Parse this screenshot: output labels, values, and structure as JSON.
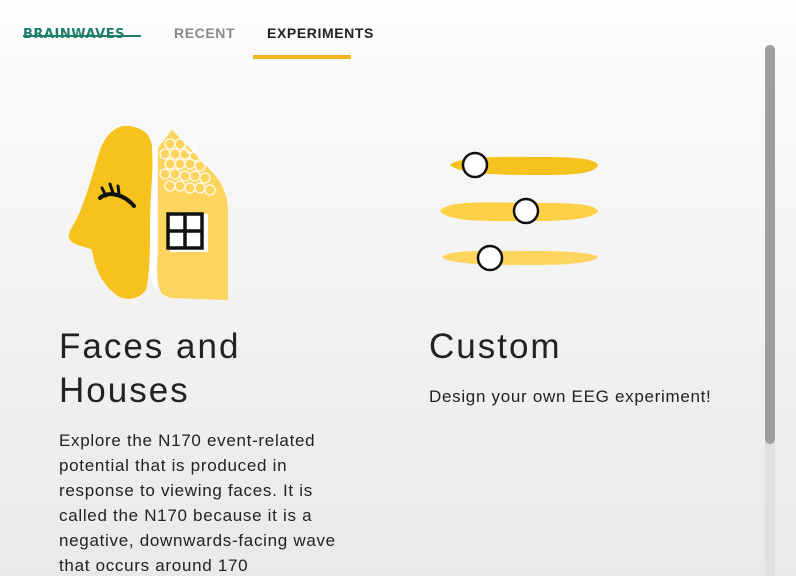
{
  "brand": {
    "logo_text": "BRAINWAVES",
    "color": "#1f7f6d"
  },
  "nav": {
    "tabs": [
      {
        "label": "RECENT",
        "active": false
      },
      {
        "label": "EXPERIMENTS",
        "active": true
      }
    ],
    "accent_color": "#f3b41b"
  },
  "experiments": [
    {
      "title": "Faces and Houses",
      "description": "Explore the N170 event-related potential that is produced in response to viewing faces. It is called the N170 because it is a negative, downwards-facing wave that occurs around 170",
      "icon": "face-house-icon"
    },
    {
      "title": "Custom",
      "description": "Design your own EEG experiment!",
      "icon": "sliders-icon"
    }
  ]
}
